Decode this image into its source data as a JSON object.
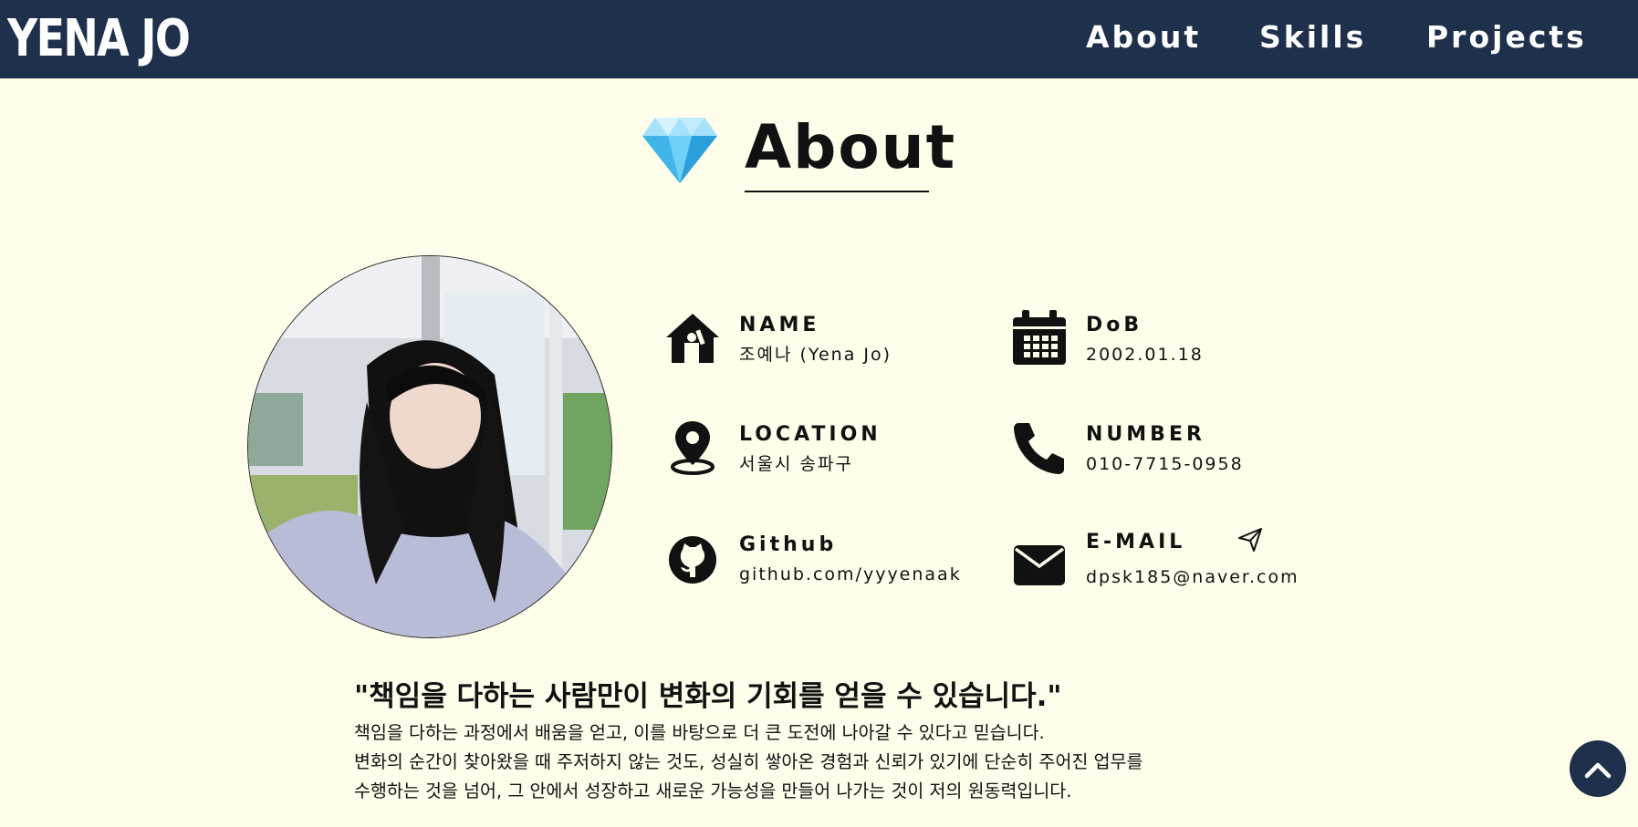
{
  "header": {
    "brand": "YENA JO",
    "nav": [
      {
        "label": "About"
      },
      {
        "label": "Skills"
      },
      {
        "label": "Projects"
      }
    ]
  },
  "about": {
    "title": "About",
    "title_icon": "diamond-icon",
    "info": [
      {
        "label": "NAME",
        "value": "조예나 (Yena Jo)",
        "icon": "house-person-icon"
      },
      {
        "label": "DoB",
        "value": "2002.01.18",
        "icon": "calendar-icon"
      },
      {
        "label": "LOCATION",
        "value": "서울시 송파구",
        "icon": "map-pin-icon"
      },
      {
        "label": "NUMBER",
        "value": "010-7715-0958",
        "icon": "phone-icon"
      },
      {
        "label": "Github",
        "value": "github.com/yyyenaak",
        "icon": "github-icon"
      },
      {
        "label": "E-MAIL",
        "value": "dpsk185@naver.com",
        "icon": "envelope-icon"
      }
    ],
    "send_icon": "send-icon",
    "quote_title": "\"책임을 다하는 사람만이 변화의 기회를 얻을 수 있습니다.\"",
    "quote_lines": [
      "책임을 다하는 과정에서 배움을 얻고, 이를 바탕으로 더 큰 도전에 나아갈 수 있다고 믿습니다.",
      "변화의 순간이 찾아왔을 때 주저하지 않는 것도, 성실히 쌓아온 경험과 신뢰가 있기에 단순히 주어진 업무를",
      "수행하는 것을 넘어, 그 안에서 성장하고 새로운 가능성을 만들어 나가는 것이 저의 원동력입니다."
    ]
  },
  "scroll_top_icon": "chevron-up-icon",
  "colors": {
    "navbar": "#1e304c",
    "background": "#fffeea",
    "diamond": "#3cb6ee"
  }
}
